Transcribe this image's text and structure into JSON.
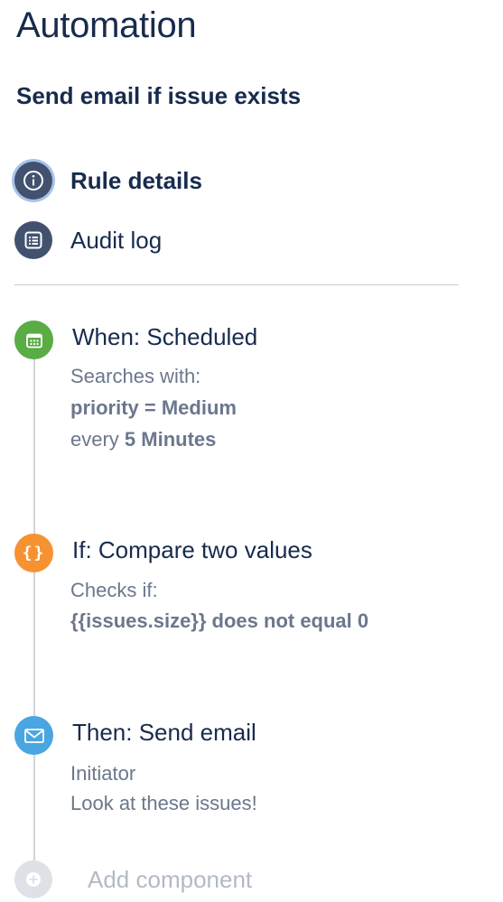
{
  "page": {
    "title": "Automation",
    "rule_name": "Send email if issue exists"
  },
  "nav": {
    "rule_details": {
      "label": "Rule details",
      "icon": "info-icon"
    },
    "audit_log": {
      "label": "Audit log",
      "icon": "list-icon"
    }
  },
  "components": {
    "trigger": {
      "heading": "When: Scheduled",
      "line1": "Searches with:",
      "line2": "priority = Medium",
      "line3_prefix": "every",
      "line3_value": "5 Minutes",
      "icon": "calendar-icon",
      "color": "#5aac44"
    },
    "condition": {
      "heading": "If: Compare two values",
      "line1": "Checks if:",
      "line2": "{{issues.size}} does not equal 0",
      "icon": "braces-icon",
      "color": "#f79232"
    },
    "action": {
      "heading": "Then: Send email",
      "line1": "Initiator",
      "line2": "Look at these issues!",
      "icon": "envelope-icon",
      "color": "#4aa6e0"
    }
  },
  "add_component": {
    "label": "Add component",
    "icon": "plus-icon"
  },
  "colors": {
    "title": "#172b4d",
    "muted": "#6b778c",
    "nav_circle": "#42526e"
  }
}
